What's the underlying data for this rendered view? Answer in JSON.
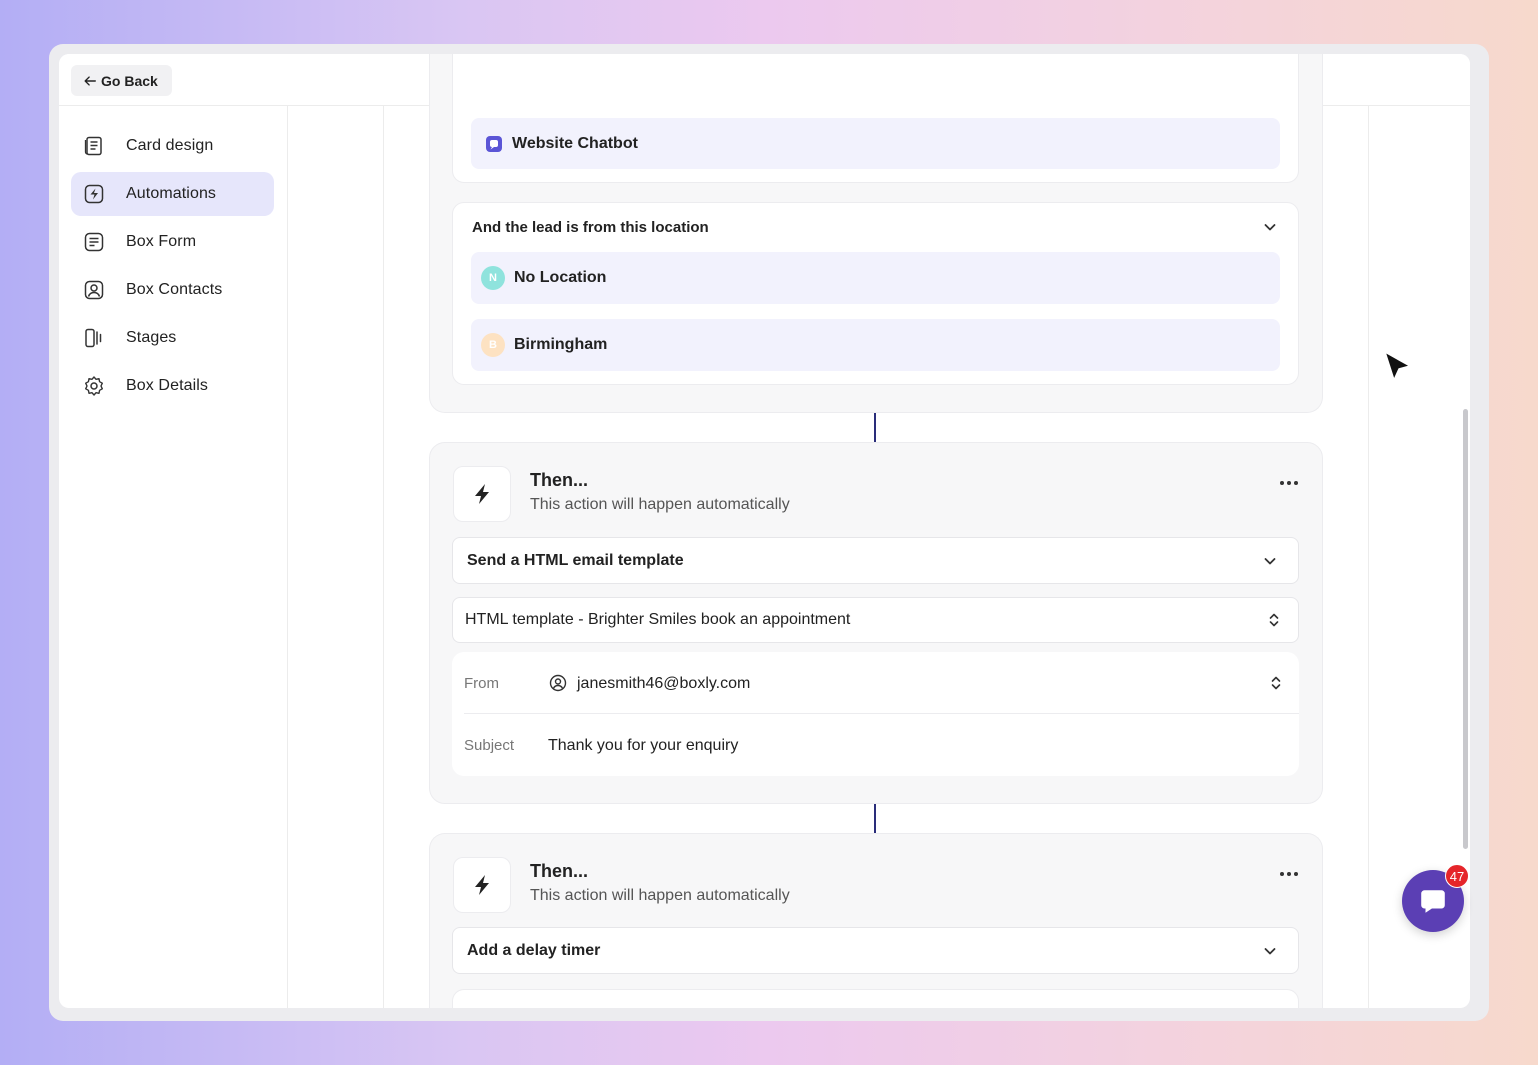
{
  "topbar": {
    "back_label": "Go Back"
  },
  "sidebar": {
    "items": [
      {
        "label": "Card design",
        "icon": "card-design-icon",
        "active": false
      },
      {
        "label": "Automations",
        "icon": "automations-icon",
        "active": true
      },
      {
        "label": "Box Form",
        "icon": "box-form-icon",
        "active": false
      },
      {
        "label": "Box Contacts",
        "icon": "box-contacts-icon",
        "active": false
      },
      {
        "label": "Stages",
        "icon": "stages-icon",
        "active": false
      },
      {
        "label": "Box Details",
        "icon": "box-details-icon",
        "active": false
      }
    ]
  },
  "trigger": {
    "source_tag": "Website Chatbot",
    "location_label": "And the lead is from this location",
    "locations": [
      {
        "initial": "N",
        "label": "No Location",
        "color": "#8fe3dd"
      },
      {
        "initial": "B",
        "label": "Birmingham",
        "color": "#fde2c2"
      }
    ]
  },
  "action1": {
    "title": "Then...",
    "subtitle": "This action will happen automatically",
    "action_select": "Send a HTML email template",
    "template_select": "HTML template - Brighter Smiles book an appointment",
    "from_label": "From",
    "from_value": "janesmith46@boxly.com",
    "subject_label": "Subject",
    "subject_value": "Thank you for your enquiry"
  },
  "action2": {
    "title": "Then...",
    "subtitle": "This action will happen automatically",
    "action_select": "Add a delay timer"
  },
  "chat": {
    "badge_count": "47"
  },
  "colors": {
    "accent": "#5b3fb4",
    "active_nav": "#e6e6fb",
    "badge": "#e5252a"
  }
}
